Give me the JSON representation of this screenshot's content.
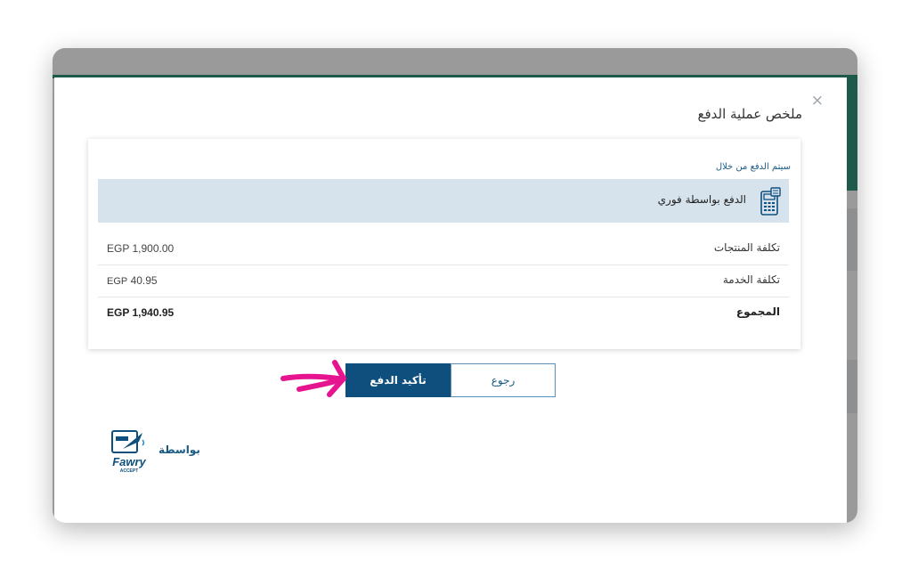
{
  "modal": {
    "title": "ملخص عملية الدفع",
    "close_glyph": "×"
  },
  "payment": {
    "subtitle": "سيتم الدفع من خلال",
    "method_label": "الدفع بواسطة فوري",
    "method_icon": "pos-terminal-icon"
  },
  "summary": {
    "rows": [
      {
        "label": "تكلفة المنتجات",
        "currency": "EGP",
        "amount": "1,900.00"
      },
      {
        "label": "تكلفة الخدمة",
        "currency": "EGP",
        "amount": "40.95"
      },
      {
        "label": "المجموع",
        "currency": "EGP",
        "amount": "1,940.95"
      }
    ]
  },
  "buttons": {
    "confirm_label": "تأكيد الدفع",
    "back_label": "رجوع"
  },
  "footer": {
    "by_label": "بواسطة",
    "brand_text": "Fawry",
    "brand_sub": "ACCEPT"
  },
  "colors": {
    "primary": "#0e4f7e",
    "accent_teal": "#005f55",
    "method_bg": "#d7e3ec",
    "annotation_arrow": "#e6158f"
  }
}
